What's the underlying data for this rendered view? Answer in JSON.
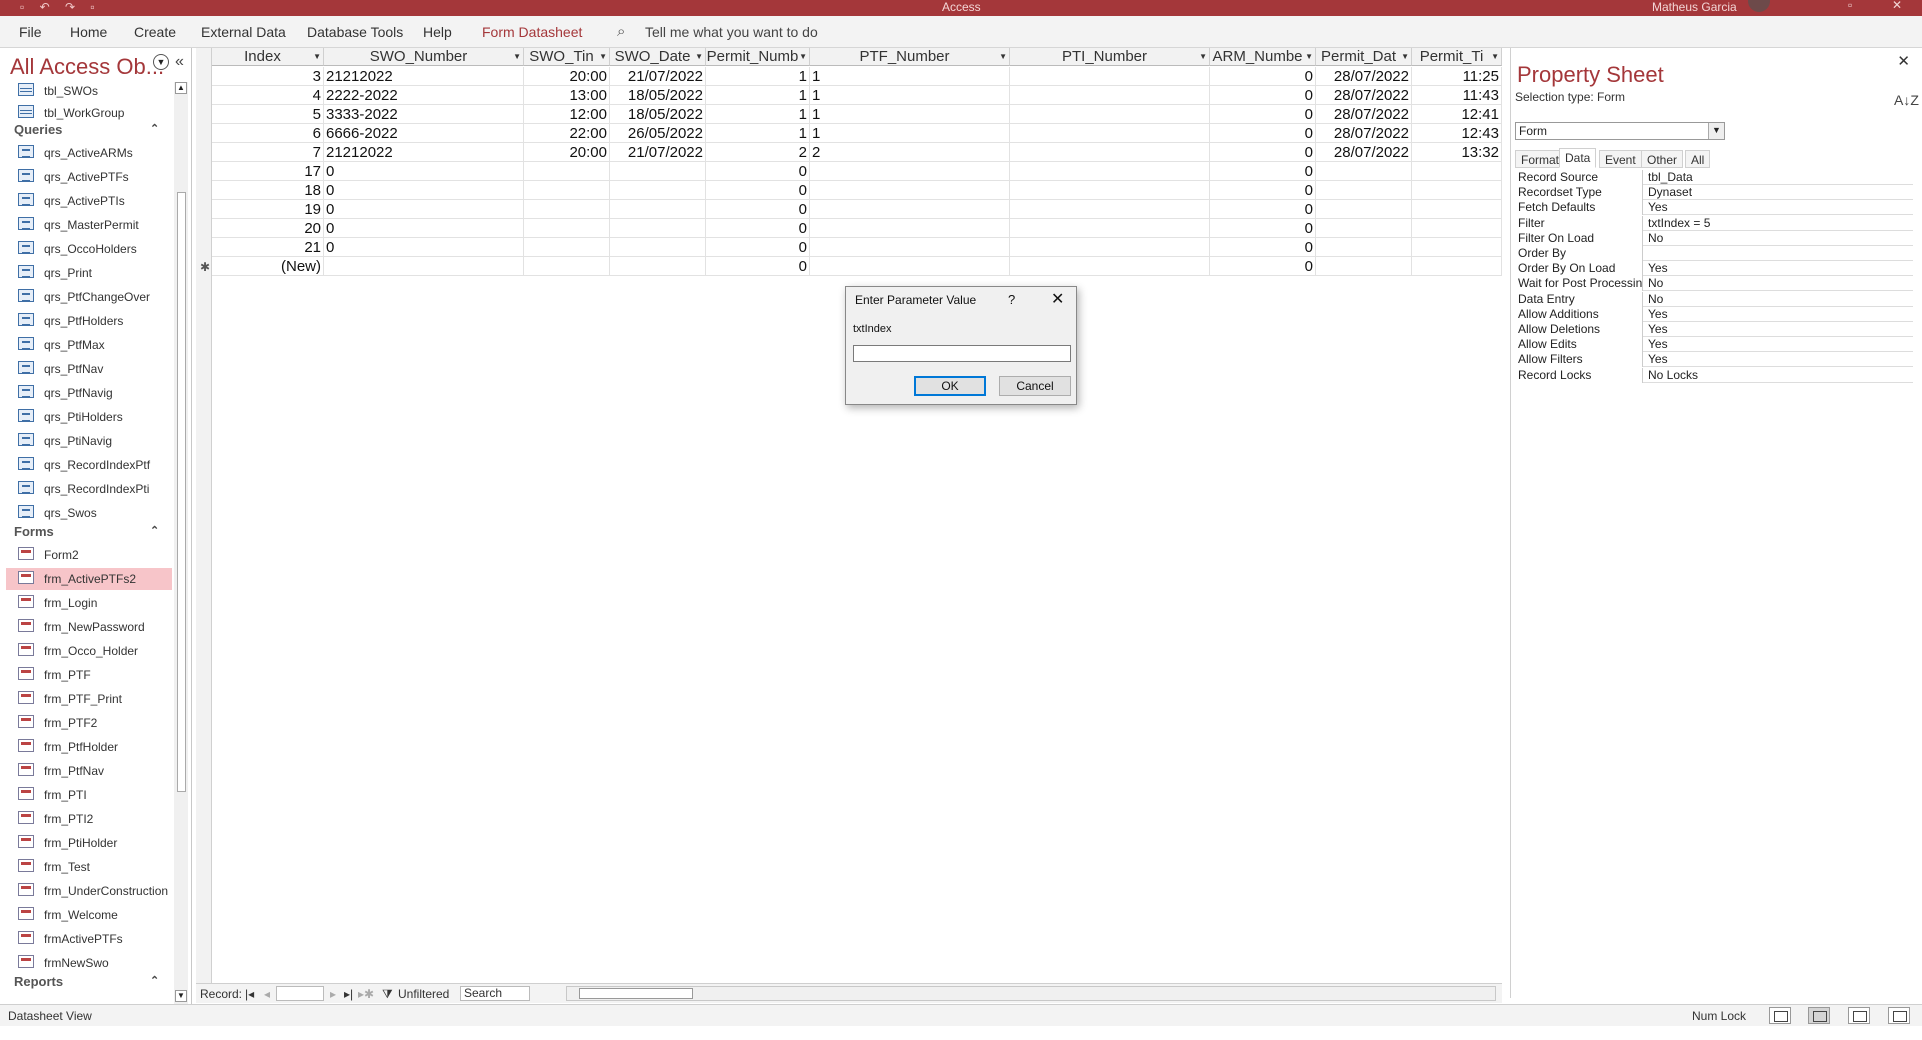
{
  "titlebar": {
    "app_title": "Access",
    "user_name": "Matheus Garcia",
    "window_buttons": [
      "▫",
      "✕"
    ]
  },
  "ribbon": {
    "tabs": [
      "File",
      "Home",
      "Create",
      "External Data",
      "Database Tools",
      "Help",
      "Form Datasheet"
    ],
    "active_tab": "Form Datasheet",
    "tell_me": "Tell me what you want to do"
  },
  "navpane": {
    "title": "All Access Ob...",
    "tables": [
      "tbl_SWOs",
      "tbl_WorkGroup"
    ],
    "queries_label": "Queries",
    "queries": [
      "qrs_ActiveARMs",
      "qrs_ActivePTFs",
      "qrs_ActivePTIs",
      "qrs_MasterPermit",
      "qrs_OccoHolders",
      "qrs_Print",
      "qrs_PtfChangeOver",
      "qrs_PtfHolders",
      "qrs_PtfMax",
      "qrs_PtfNav",
      "qrs_PtfNavig",
      "qrs_PtiHolders",
      "qrs_PtiNavig",
      "qrs_RecordIndexPtf",
      "qrs_RecordIndexPti",
      "qrs_Swos"
    ],
    "forms_label": "Forms",
    "forms": [
      "Form2",
      "frm_ActivePTFs2",
      "frm_Login",
      "frm_NewPassword",
      "frm_Occo_Holder",
      "frm_PTF",
      "frm_PTF_Print",
      "frm_PTF2",
      "frm_PtfHolder",
      "frm_PtfNav",
      "frm_PTI",
      "frm_PTI2",
      "frm_PtiHolder",
      "frm_Test",
      "frm_UnderConstruction",
      "frm_Welcome",
      "frmActivePTFs",
      "frmNewSwo"
    ],
    "selected_form": "frm_ActivePTFs2",
    "reports_label": "Reports"
  },
  "datasheet": {
    "columns": [
      "Index",
      "SWO_Number",
      "SWO_Tin",
      "SWO_Date",
      "Permit_Numb",
      "PTF_Number",
      "PTI_Number",
      "ARM_Numbe",
      "Permit_Dat",
      "Permit_Ti"
    ],
    "rows": [
      [
        "3",
        "21212022",
        "20:00",
        "21/07/2022",
        "1",
        "1",
        "",
        "0",
        "28/07/2022",
        "11:25"
      ],
      [
        "4",
        "2222-2022",
        "13:00",
        "18/05/2022",
        "1",
        "1",
        "",
        "0",
        "28/07/2022",
        "11:43"
      ],
      [
        "5",
        "3333-2022",
        "12:00",
        "18/05/2022",
        "1",
        "1",
        "",
        "0",
        "28/07/2022",
        "12:41"
      ],
      [
        "6",
        "6666-2022",
        "22:00",
        "26/05/2022",
        "1",
        "1",
        "",
        "0",
        "28/07/2022",
        "12:43"
      ],
      [
        "7",
        "21212022",
        "20:00",
        "21/07/2022",
        "2",
        "2",
        "",
        "0",
        "28/07/2022",
        "13:32"
      ],
      [
        "17",
        "0",
        "",
        "",
        "0",
        "",
        "",
        "0",
        "",
        ""
      ],
      [
        "18",
        "0",
        "",
        "",
        "0",
        "",
        "",
        "0",
        "",
        ""
      ],
      [
        "19",
        "0",
        "",
        "",
        "0",
        "",
        "",
        "0",
        "",
        ""
      ],
      [
        "20",
        "0",
        "",
        "",
        "0",
        "",
        "",
        "0",
        "",
        ""
      ],
      [
        "21",
        "0",
        "",
        "",
        "0",
        "",
        "",
        "0",
        "",
        ""
      ],
      [
        "(New)",
        "",
        "",
        "",
        "0",
        "",
        "",
        "0",
        "",
        ""
      ]
    ],
    "new_row_marker": "✱"
  },
  "record_nav": {
    "label": "Record:",
    "filter_status": "Unfiltered",
    "search_placeholder": "Search"
  },
  "property_sheet": {
    "title": "Property Sheet",
    "selection_type": "Selection type:  Form",
    "object": "Form",
    "tabs": [
      "Format",
      "Data",
      "Event",
      "Other",
      "All"
    ],
    "active_tab": "Data",
    "properties": [
      [
        "Record Source",
        "tbl_Data"
      ],
      [
        "Recordset Type",
        "Dynaset"
      ],
      [
        "Fetch Defaults",
        "Yes"
      ],
      [
        "Filter",
        "txtIndex = 5"
      ],
      [
        "Filter On Load",
        "No"
      ],
      [
        "Order By",
        ""
      ],
      [
        "Order By On Load",
        "Yes"
      ],
      [
        "Wait for Post Processing",
        "No"
      ],
      [
        "Data Entry",
        "No"
      ],
      [
        "Allow Additions",
        "Yes"
      ],
      [
        "Allow Deletions",
        "Yes"
      ],
      [
        "Allow Edits",
        "Yes"
      ],
      [
        "Allow Filters",
        "Yes"
      ],
      [
        "Record Locks",
        "No Locks"
      ]
    ]
  },
  "dialog": {
    "title": "Enter Parameter Value",
    "help": "?",
    "prompt": "txtIndex",
    "value": "",
    "ok_label": "OK",
    "cancel_label": "Cancel"
  },
  "status": {
    "view": "Datasheet View",
    "num_lock": "Num Lock"
  },
  "colors": {
    "accent": "#a4373a",
    "selected_nav": "#f7c5c9",
    "ok_focus": "#0078d7"
  }
}
